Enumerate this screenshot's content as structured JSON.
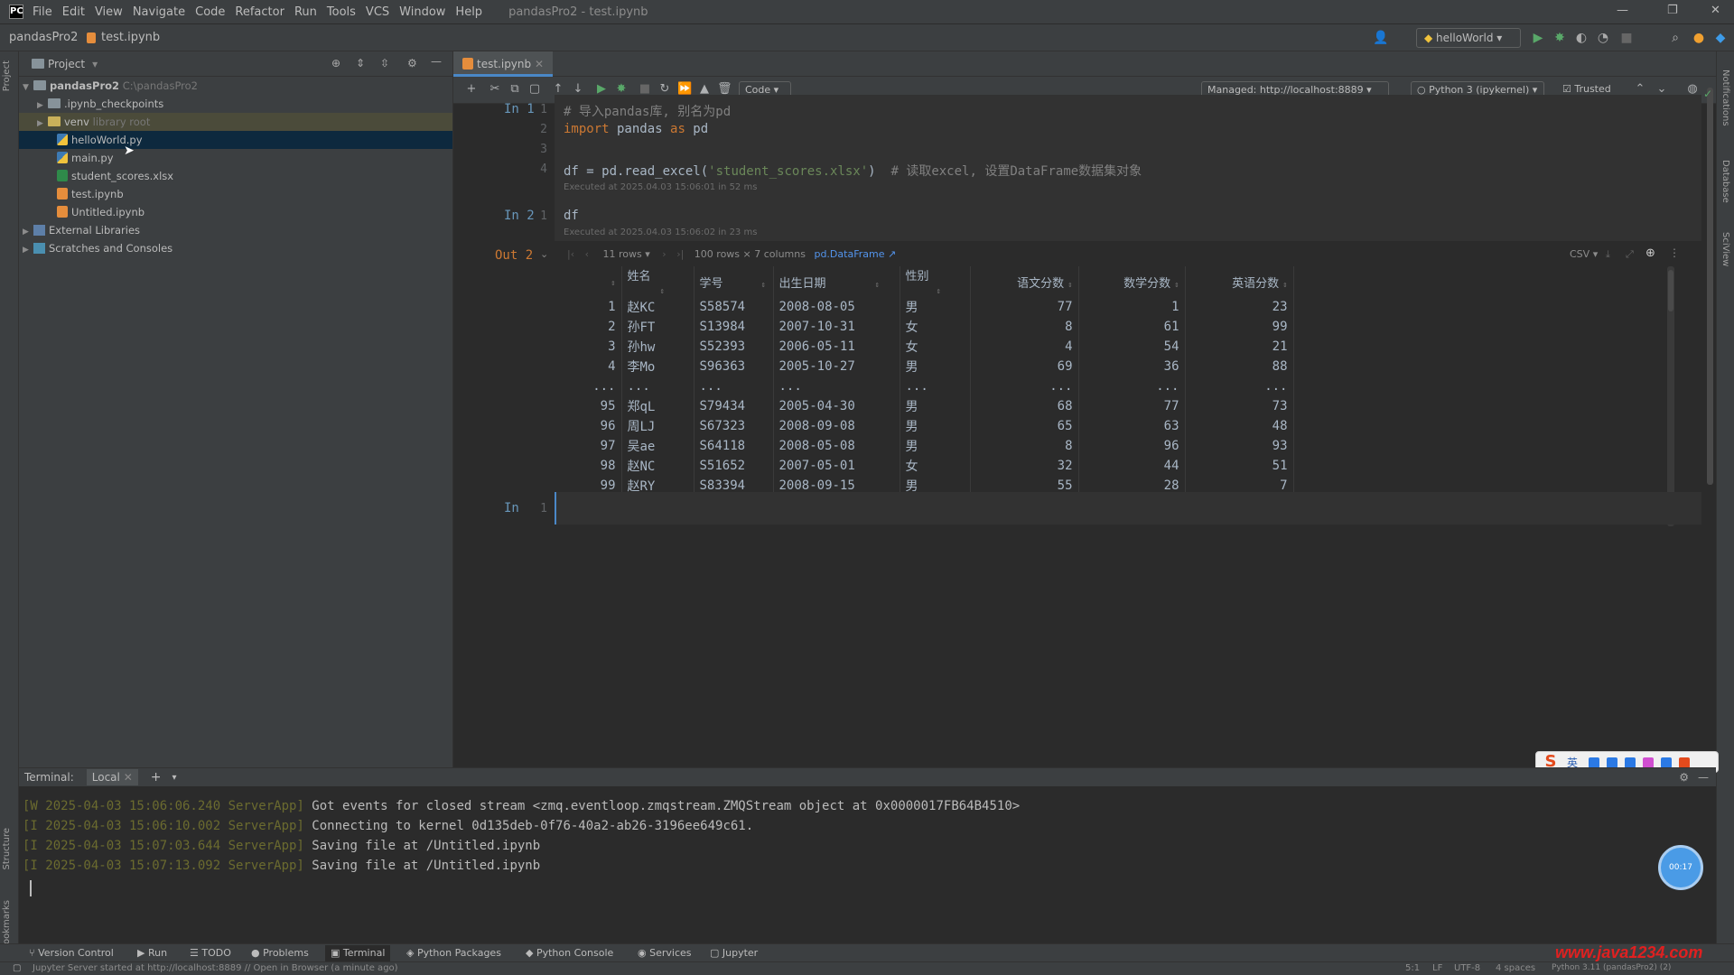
{
  "menubar": {
    "items": [
      "File",
      "Edit",
      "View",
      "Navigate",
      "Code",
      "Refactor",
      "Run",
      "Tools",
      "VCS",
      "Window",
      "Help"
    ],
    "window_title": "pandasPro2 - test.ipynb"
  },
  "navbar": {
    "project": "pandasPro2",
    "file": "test.ipynb",
    "run_config": "helloWorld"
  },
  "project_panel": {
    "title": "Project",
    "tree": [
      {
        "label": "pandasPro2",
        "suffix": "C:\\pandasPro2",
        "type": "folder"
      },
      {
        "label": ".ipynb_checkpoints",
        "suffix": "",
        "type": "folder"
      },
      {
        "label": "venv",
        "suffix": "library root",
        "type": "folder"
      },
      {
        "label": "helloWorld.py",
        "suffix": "",
        "type": "py"
      },
      {
        "label": "main.py",
        "suffix": "",
        "type": "py"
      },
      {
        "label": "student_scores.xlsx",
        "suffix": "",
        "type": "xlsx"
      },
      {
        "label": "test.ipynb",
        "suffix": "",
        "type": "nb"
      },
      {
        "label": "Untitled.ipynb",
        "suffix": "",
        "type": "nb"
      },
      {
        "label": "External Libraries",
        "suffix": "",
        "type": "lib"
      },
      {
        "label": "Scratches and Consoles",
        "suffix": "",
        "type": "lib"
      }
    ]
  },
  "editor": {
    "tab": "test.ipynb",
    "cell_type": "Code",
    "server": "Managed: http://localhost:8889",
    "kernel": "Python 3 (ipykernel)",
    "trusted": "Trusted",
    "cells": {
      "in1_label": "In  1",
      "in1_line1": "# 导入pandas库, 别名为pd",
      "in1_line2_kw": "import",
      "in1_line2_mod": " pandas ",
      "in1_line2_as": "as",
      "in1_line2_alias": " pd",
      "in1_line4_a": "df = pd.read_excel(",
      "in1_line4_str": "'student_scores.xlsx'",
      "in1_line4_b": ")  ",
      "in1_line4_cmt": "# 读取excel, 设置DataFrame数据集对象",
      "in1_exec": "Executed at 2025.04.03 15:06:01 in 52 ms",
      "in2_label": "In  2",
      "in2_code": "df",
      "in2_exec": "Executed at 2025.04.03 15:06:02 in 23 ms",
      "out2_label": "Out 2",
      "in3_label": "In  ",
      "df_rows_select": "11 rows",
      "df_info": "100 rows × 7 columns",
      "df_type": "pd.DataFrame",
      "df_export": "CSV"
    }
  },
  "dataframe": {
    "columns": [
      "",
      "姓名",
      "学号",
      "出生日期",
      "性别",
      "语文分数",
      "数学分数",
      "英语分数"
    ],
    "rows": [
      [
        "1",
        "赵KC",
        "S58574",
        "2008-08-05",
        "男",
        "77",
        "1",
        "23"
      ],
      [
        "2",
        "孙FT",
        "S13984",
        "2007-10-31",
        "女",
        "8",
        "61",
        "99"
      ],
      [
        "3",
        "孙hw",
        "S52393",
        "2006-05-11",
        "女",
        "4",
        "54",
        "21"
      ],
      [
        "4",
        "李Mo",
        "S96363",
        "2005-10-27",
        "男",
        "69",
        "36",
        "88"
      ],
      [
        "...",
        "...",
        "...",
        "...",
        "...",
        "...",
        "...",
        "..."
      ],
      [
        "95",
        "郑qL",
        "S79434",
        "2005-04-30",
        "男",
        "68",
        "77",
        "73"
      ],
      [
        "96",
        "周LJ",
        "S67323",
        "2008-09-08",
        "男",
        "65",
        "63",
        "48"
      ],
      [
        "97",
        "吴ae",
        "S64118",
        "2008-05-08",
        "男",
        "8",
        "96",
        "93"
      ],
      [
        "98",
        "赵NC",
        "S51652",
        "2007-05-01",
        "女",
        "32",
        "44",
        "51"
      ],
      [
        "99",
        "赵RY",
        "S83394",
        "2008-09-15",
        "男",
        "55",
        "28",
        "7"
      ]
    ]
  },
  "terminal": {
    "title": "Terminal:",
    "tab": "Local",
    "lines": [
      {
        "prefix": "[W 2025-04-03 15:06:06.240 ServerApp]",
        "msg": " Got events for closed stream <zmq.eventloop.zmqstream.ZMQStream object at 0x0000017FB64B4510>"
      },
      {
        "prefix": "[I 2025-04-03 15:06:10.002 ServerApp]",
        "msg": " Connecting to kernel 0d135deb-0f76-40a2-ab26-3196ee649c61."
      },
      {
        "prefix": "[I 2025-04-03 15:07:03.644 ServerApp]",
        "msg": " Saving file at /Untitled.ipynb"
      },
      {
        "prefix": "[I 2025-04-03 15:07:13.092 ServerApp]",
        "msg": " Saving file at /Untitled.ipynb"
      }
    ]
  },
  "bottom_tools": [
    "Version Control",
    "Run",
    "TODO",
    "Problems",
    "Terminal",
    "Python Packages",
    "Python Console",
    "Services",
    "Jupyter"
  ],
  "status": {
    "message": "Jupyter Server started at http://localhost:8889 // Open in Browser (a minute ago)",
    "position": "5:1",
    "line_sep": "LF",
    "encoding": "UTF-8",
    "indent": "4 spaces",
    "interpreter": "Python 3.11 (pandasPro2) (2)"
  },
  "overlays": {
    "ime_lang": "英",
    "bubble": "00:17",
    "watermark": "www.java1234.com"
  }
}
